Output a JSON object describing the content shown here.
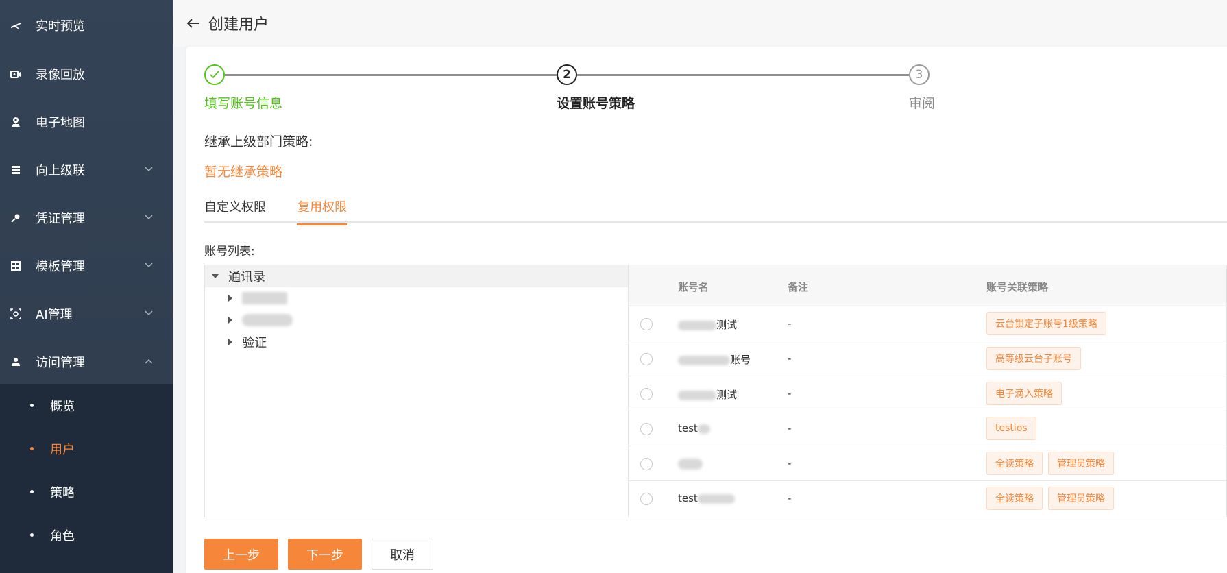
{
  "sidebar": {
    "items": [
      {
        "label": "实时预览",
        "icon": "live-preview-icon"
      },
      {
        "label": "录像回放",
        "icon": "video-playback-icon"
      },
      {
        "label": "电子地图",
        "icon": "map-icon"
      },
      {
        "label": "向上级联",
        "icon": "cascade-icon"
      },
      {
        "label": "凭证管理",
        "icon": "key-icon"
      },
      {
        "label": "模板管理",
        "icon": "template-icon"
      },
      {
        "label": "AI管理",
        "icon": "ai-icon"
      },
      {
        "label": "访问管理",
        "icon": "user-icon"
      }
    ],
    "sub_items": [
      {
        "label": "概览"
      },
      {
        "label": "用户"
      },
      {
        "label": "策略"
      },
      {
        "label": "角色"
      }
    ],
    "active_sub": "用户"
  },
  "header": {
    "title": "创建用户"
  },
  "steps": [
    {
      "number": "1",
      "label": "填写账号信息",
      "status": "done"
    },
    {
      "number": "2",
      "label": "设置账号策略",
      "status": "current"
    },
    {
      "number": "3",
      "label": "审阅",
      "status": "pending"
    }
  ],
  "inherit": {
    "title": "继承上级部门策略:",
    "empty_text": "暂无继承策略"
  },
  "tabs": [
    {
      "label": "自定义权限"
    },
    {
      "label": "复用权限"
    }
  ],
  "account_list_label": "账号列表:",
  "tree": {
    "root": "通讯录",
    "children": [
      "",
      "",
      "验证"
    ]
  },
  "table": {
    "headers": {
      "name": "账号名",
      "remark": "备注",
      "policy": "账号关联策略"
    },
    "rows": [
      {
        "name_visible": "测试",
        "remark": "-",
        "tags": [
          "云台锁定子账号1级策略"
        ]
      },
      {
        "name_visible": "账号",
        "remark": "-",
        "tags": [
          "高等级云台子账号"
        ]
      },
      {
        "name_visible": "测试",
        "remark": "-",
        "tags": [
          "电子滴入策略"
        ]
      },
      {
        "name_visible": "test",
        "remark": "-",
        "tags": [
          "testios"
        ]
      },
      {
        "name_visible": "",
        "remark": "-",
        "tags": [
          "全读策略",
          "管理员策略"
        ]
      },
      {
        "name_visible": "test",
        "remark": "-",
        "tags": [
          "全读策略",
          "管理员策略"
        ]
      }
    ]
  },
  "buttons": {
    "prev": "上一步",
    "next": "下一步",
    "cancel": "取消"
  },
  "colors": {
    "accent": "#f6873a",
    "success": "#52c41a",
    "sidebar_bg": "#344356",
    "submenu_bg": "#1f2b3b"
  }
}
